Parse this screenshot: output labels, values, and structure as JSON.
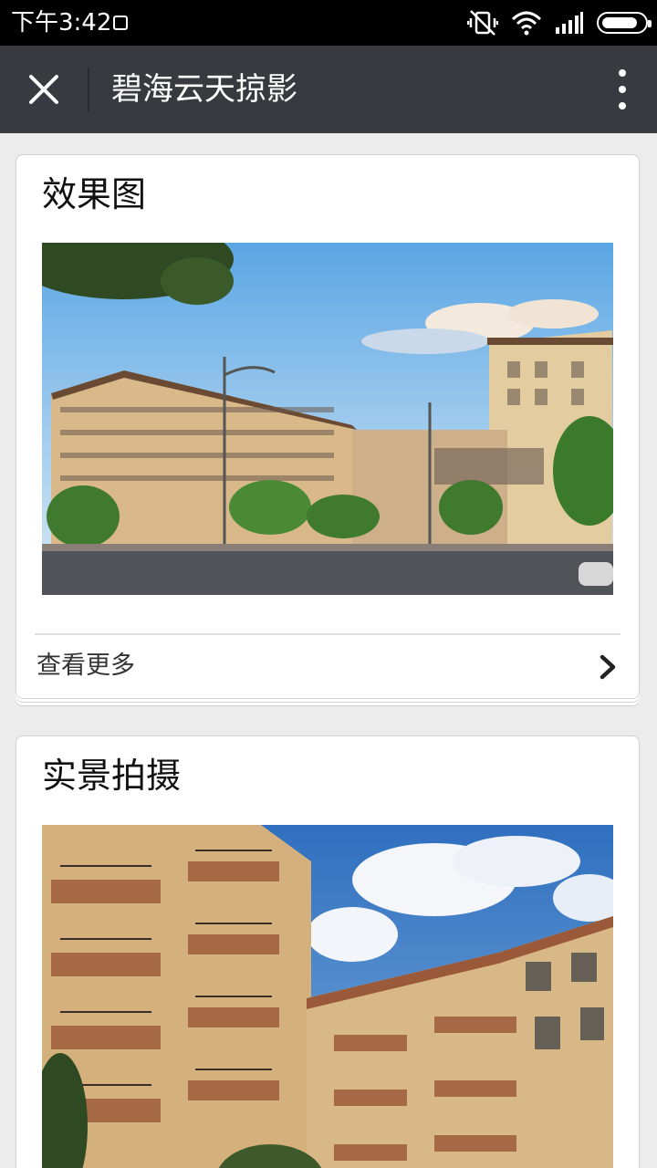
{
  "status": {
    "time": "下午3:42"
  },
  "titlebar": {
    "title": "碧海云天掠影"
  },
  "sections": [
    {
      "title": "效果图",
      "more_label": "查看更多"
    },
    {
      "title": "实景拍摄"
    }
  ],
  "colors": {
    "titlebar_bg": "#393a3f",
    "status_bg": "#000000",
    "page_bg": "#ececec"
  },
  "icons": {
    "close": "close-icon",
    "more": "more-vertical-icon",
    "chevron": "chevron-right-icon"
  }
}
